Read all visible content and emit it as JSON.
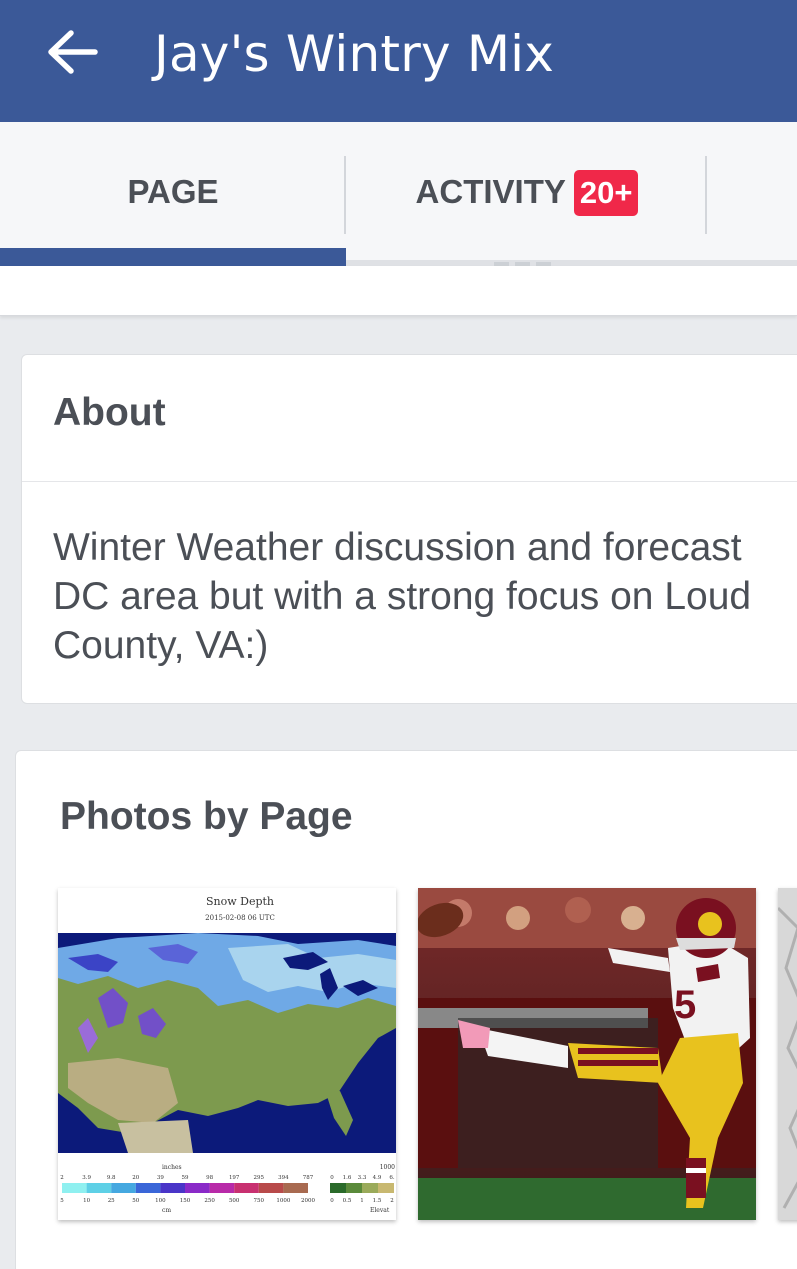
{
  "appbar": {
    "title": "Jay's Wintry Mix",
    "back_icon": "arrow-left-icon"
  },
  "tabs": [
    {
      "label": "PAGE",
      "active": true
    },
    {
      "label": "ACTIVITY",
      "badge": "20+"
    }
  ],
  "about": {
    "title": "About",
    "text": "Winter Weather discussion and forecast\nDC area but with a strong focus on Loud\nCounty, VA:)"
  },
  "photos": {
    "title": "Photos by Page",
    "items": [
      {
        "kind": "snow-depth-map",
        "caption_title": "Snow Depth",
        "caption_date": "2015-02-08 06 UTC",
        "legend_label": "inches",
        "legend_inches": [
          "2",
          "3.9",
          "9.8",
          "20",
          "39",
          "59",
          "98",
          "197",
          "295",
          "394",
          "787"
        ],
        "legend_cm": [
          "5",
          "10",
          "25",
          "50",
          "100",
          "150",
          "250",
          "500",
          "750",
          "1000",
          "2000"
        ],
        "legend_cm_label": "cm",
        "elev_values_top": [
          "0",
          "1.6",
          "3.3",
          "4.9",
          "6."
        ],
        "elev_values_bottom": [
          "0",
          "0.5",
          "1",
          "1.5",
          "2"
        ],
        "elev_max": "1000",
        "elev_label": "Elevat"
      },
      {
        "kind": "football-kicker-photo",
        "jersey_number": "5"
      },
      {
        "kind": "partial-map-photo"
      }
    ]
  },
  "colors": {
    "brand": "#3b5998",
    "badge": "#f02849",
    "text": "#4b4f56",
    "background": "#e9ebee"
  }
}
